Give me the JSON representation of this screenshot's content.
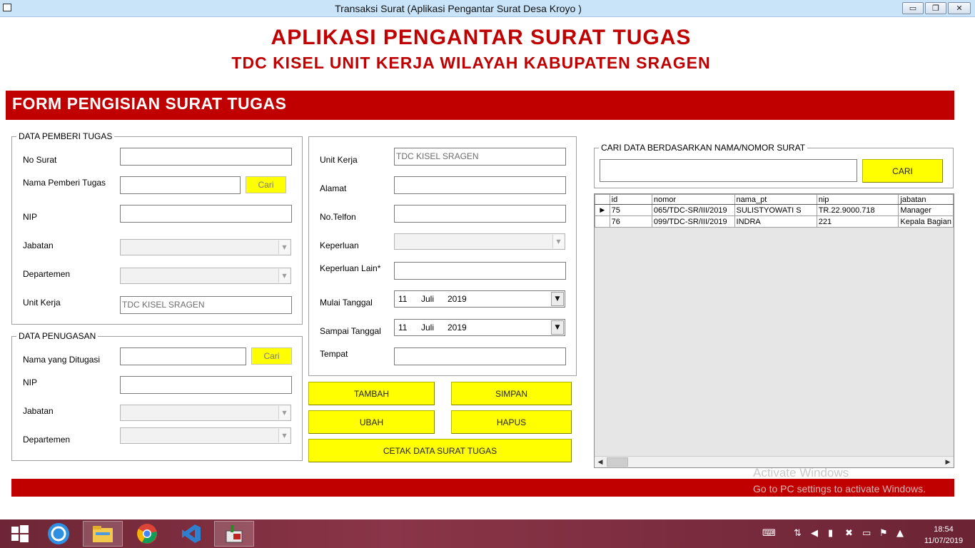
{
  "window": {
    "title": "Transaksi Surat (Aplikasi Pengantar Surat Desa Kroyo )",
    "min_glyph": "▭",
    "max_glyph": "❐",
    "close_glyph": "✕"
  },
  "header": {
    "title": "APLIKASI PENGANTAR SURAT TUGAS",
    "subtitle": "TDC KISEL UNIT KERJA WILAYAH KABUPATEN SRAGEN",
    "banner": "FORM PENGISIAN SURAT TUGAS"
  },
  "pemberi": {
    "legend": "DATA PEMBERI TUGAS",
    "no_surat_label": "No Surat",
    "no_surat_value": "",
    "nama_label": "Nama Pemberi Tugas",
    "nama_value": "",
    "cari_label": "Cari",
    "nip_label": "NIP",
    "nip_value": "",
    "jabatan_label": "Jabatan",
    "departemen_label": "Departemen",
    "unit_kerja_label": "Unit Kerja",
    "unit_kerja_value": "TDC KISEL SRAGEN"
  },
  "penugasan": {
    "legend": "DATA PENUGASAN",
    "nama_label": "Nama yang Ditugasi",
    "nama_value": "",
    "cari_label": "Cari",
    "nip_label": "NIP",
    "nip_value": "",
    "jabatan_label": "Jabatan",
    "departemen_label": "Departemen"
  },
  "detail": {
    "unit_kerja_label": "Unit Kerja",
    "unit_kerja_value": "TDC KISEL SRAGEN",
    "alamat_label": "Alamat",
    "telfon_label": "No.Telfon",
    "keperluan_label": "Keperluan",
    "keperluan_lain_label": "Keperluan Lain*",
    "mulai_label": "Mulai Tanggal",
    "mulai_day": "11",
    "mulai_month": "Juli",
    "mulai_year": "2019",
    "sampai_label": "Sampai Tanggal",
    "sampai_day": "11",
    "sampai_month": "Juli",
    "sampai_year": "2019",
    "tempat_label": "Tempat"
  },
  "actions": {
    "tambah": "TAMBAH",
    "simpan": "SIMPAN",
    "ubah": "UBAH",
    "hapus": "HAPUS",
    "cetak": "CETAK DATA SURAT TUGAS"
  },
  "search": {
    "legend": "CARI DATA BERDASARKAN NAMA/NOMOR SURAT",
    "value": "",
    "button": "CARI"
  },
  "grid": {
    "columns": [
      "id",
      "nomor",
      "nama_pt",
      "nip",
      "jabatan"
    ],
    "rows": [
      [
        "75",
        "065/TDC-SR/III/2019",
        "SULISTYOWATI S",
        "TR.22.9000.718",
        "Manager"
      ],
      [
        "76",
        "099/TDC-SR/III/2019",
        "INDRA",
        "221",
        "Kepala Bagian"
      ]
    ],
    "current_row_marker": "▶"
  },
  "watermark": {
    "line1": "Activate Windows",
    "line2": "Go to PC settings to activate Windows."
  },
  "taskbar": {
    "time": "18:54",
    "date": "11/07/2019",
    "icons": [
      "windows-start-icon",
      "sync-icon",
      "file-explorer-icon",
      "chrome-icon",
      "visual-studio-icon",
      "vb6-app-icon"
    ]
  }
}
